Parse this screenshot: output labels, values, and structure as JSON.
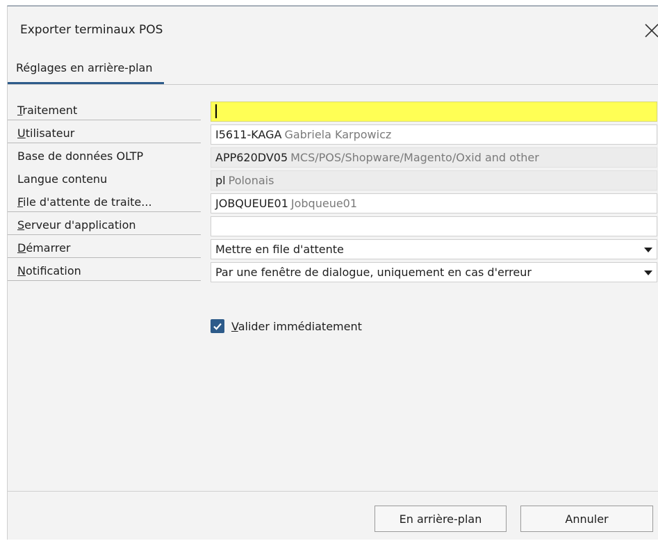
{
  "dialog": {
    "title": "Exporter terminaux POS"
  },
  "tabs": [
    {
      "label": "Réglages en arrière-plan",
      "active": true
    }
  ],
  "form": {
    "traitement": {
      "label_ul": "T",
      "label_rest": "raitement",
      "value": ""
    },
    "utilisateur": {
      "label_ul": "U",
      "label_rest": "tilisateur",
      "code": "I5611-KAGA",
      "desc": "Gabriela Karpowicz"
    },
    "base_oltp": {
      "label": "Base de données OLTP",
      "code": "APP620DV05",
      "desc": "MCS/POS/Shopware/Magento/Oxid and other"
    },
    "langue": {
      "label": "Langue contenu",
      "code": "pl",
      "desc": "Polonais"
    },
    "file_attente": {
      "label_ul": "F",
      "label_rest": "ile d'attente de traite...",
      "code": "JOBQUEUE01",
      "desc": "Jobqueue01"
    },
    "serveur": {
      "label_ul": "S",
      "label_rest": "erveur d'application",
      "value": ""
    },
    "demarrer": {
      "label_ul": "D",
      "label_rest": "émarrer",
      "value": "Mettre en file d'attente"
    },
    "notification": {
      "label_ul": "N",
      "label_rest": "otification",
      "value": "Par une fenêtre de dialogue, uniquement en cas d'erreur"
    }
  },
  "checkbox": {
    "label_ul": "V",
    "label_rest": "alider immédiatement",
    "checked": true
  },
  "buttons": {
    "background": "En arrière-plan",
    "cancel": "Annuler"
  },
  "colors": {
    "accent": "#2d5b8a",
    "required_field": "#ffff55"
  }
}
